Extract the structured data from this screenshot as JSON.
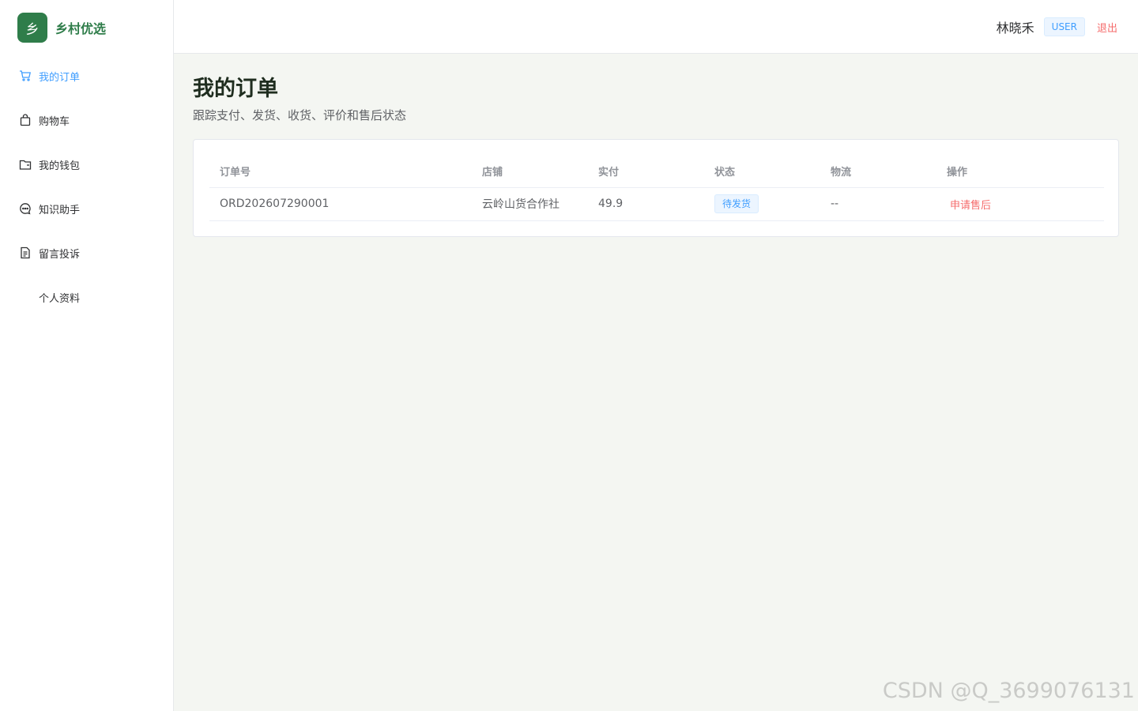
{
  "brand": {
    "logo_char": "乡",
    "name": "乡村优选"
  },
  "sidebar": {
    "items": [
      {
        "label": "我的订单",
        "icon": "cart-icon",
        "active": true
      },
      {
        "label": "购物车",
        "icon": "shopping-bag-icon"
      },
      {
        "label": "我的钱包",
        "icon": "wallet-icon"
      },
      {
        "label": "知识助手",
        "icon": "chat-bubble-icon"
      },
      {
        "label": "留言投诉",
        "icon": "document-icon"
      },
      {
        "label": "个人资料",
        "icon": ""
      }
    ]
  },
  "header": {
    "user_name": "林晓禾",
    "role": "USER",
    "logout": "退出"
  },
  "main": {
    "title": "我的订单",
    "subtitle": "跟踪支付、发货、收货、评价和售后状态",
    "table": {
      "columns": [
        "订单号",
        "店铺",
        "实付",
        "状态",
        "物流",
        "操作"
      ],
      "rows": [
        {
          "order_no": "ORD202607290001",
          "store": "云岭山货合作社",
          "paid": "49.9",
          "status": "待发货",
          "logistics": "--",
          "action": "申请售后"
        }
      ]
    }
  },
  "watermark": "CSDN @Q_3699076131",
  "colors": {
    "brand": "#2f7d4a",
    "accent": "#409eff",
    "danger": "#f56c6c"
  }
}
